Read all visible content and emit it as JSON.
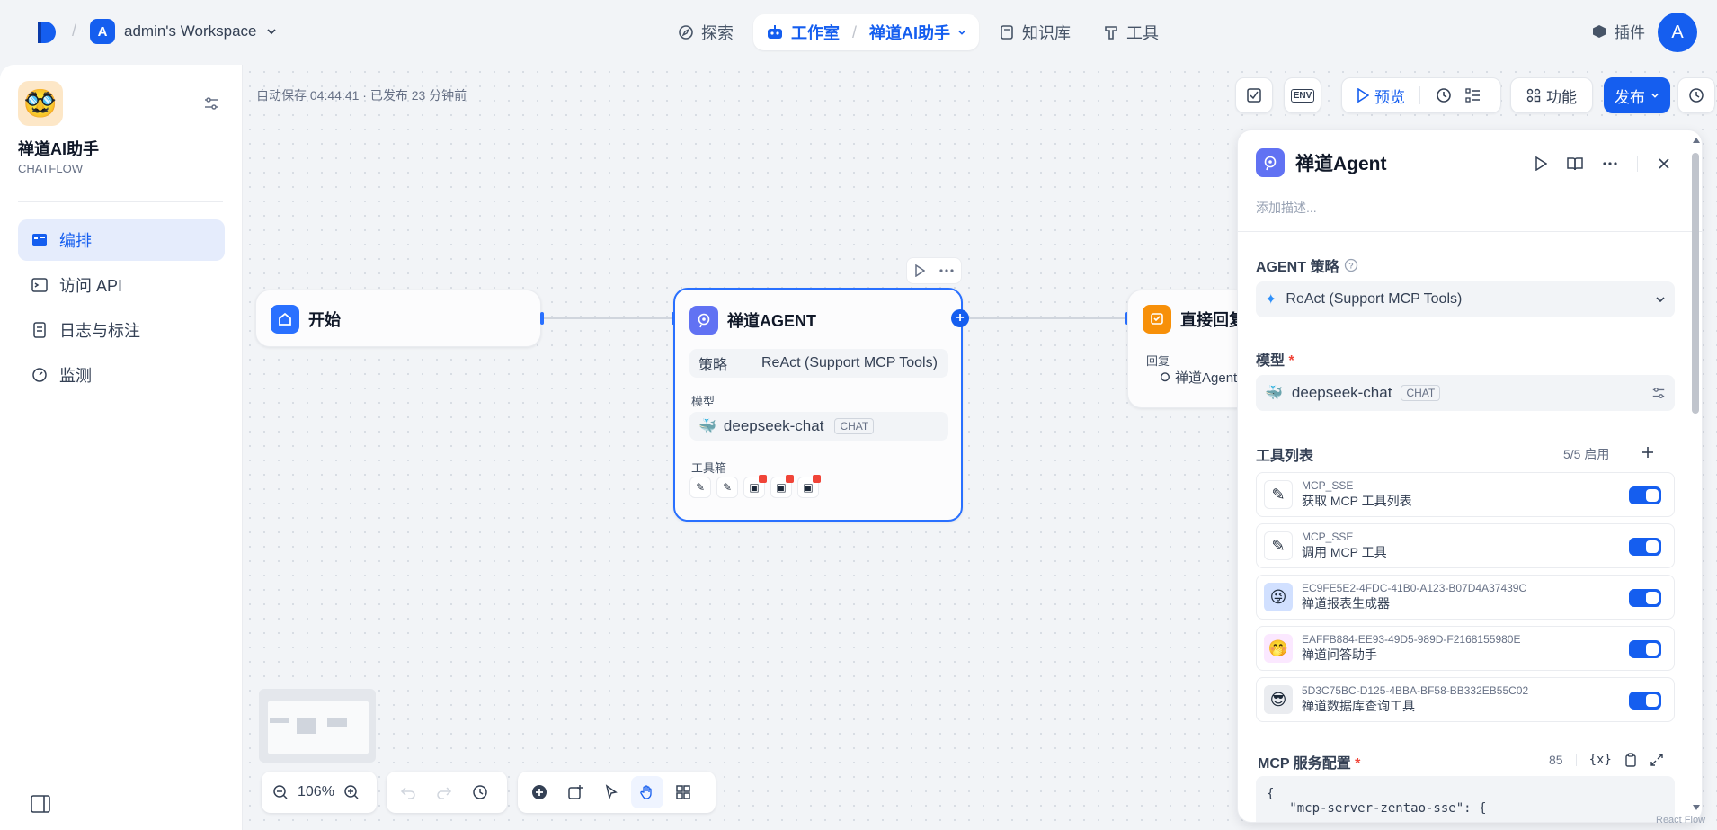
{
  "topbar": {
    "workspace_initial": "A",
    "workspace_name": "admin's Workspace",
    "nav": {
      "explore": "探索",
      "studio": "工作室",
      "current_app": "禅道AI助手",
      "knowledge": "知识库",
      "tools": "工具"
    },
    "plugins": "插件",
    "user_initial": "A"
  },
  "sidebar": {
    "app_name": "禅道AI助手",
    "app_type": "CHATFLOW",
    "items": [
      {
        "label": "编排",
        "icon": "layout-icon",
        "active": true
      },
      {
        "label": "访问 API",
        "icon": "terminal-icon",
        "active": false
      },
      {
        "label": "日志与标注",
        "icon": "log-icon",
        "active": false
      },
      {
        "label": "监测",
        "icon": "monitor-icon",
        "active": false
      }
    ]
  },
  "canvas": {
    "autosave": "自动保存 04:44:41 · 已发布 23 分钟前",
    "toolbar": {
      "env": "ENV",
      "preview": "预览",
      "features": "功能",
      "publish": "发布"
    },
    "zoom": "106%",
    "nodes": {
      "start": {
        "title": "开始"
      },
      "agent": {
        "title": "禅道AGENT",
        "strategy_label": "策略",
        "strategy_value": "ReAct (Support MCP Tools)",
        "model_label": "模型",
        "model_name": "deepseek-chat",
        "model_tag": "CHAT",
        "toolbox_label": "工具箱"
      },
      "answer": {
        "title": "直接回复",
        "reply_label": "回复",
        "reply_value": "禅道Agent"
      }
    },
    "watermark": "React Flow"
  },
  "panel": {
    "title": "禅道Agent",
    "description_placeholder": "添加描述...",
    "strategy_label": "AGENT 策略",
    "strategy_value": "ReAct (Support MCP Tools)",
    "model_label": "模型",
    "model_name": "deepseek-chat",
    "model_tag": "CHAT",
    "tools_label": "工具列表",
    "tools_count": "5/5 启用",
    "tools": [
      {
        "provider": "MCP_SSE",
        "name": "获取 MCP 工具列表",
        "icon": "mcp-icon",
        "enabled": true
      },
      {
        "provider": "MCP_SSE",
        "name": "调用 MCP 工具",
        "icon": "mcp-icon",
        "enabled": true
      },
      {
        "provider": "EC9FE5E2-4FDC-41B0-A123-B07D4A37439C",
        "name": "禅道报表生成器",
        "icon": "emoji-icon",
        "enabled": true
      },
      {
        "provider": "EAFFB884-EE93-49D5-989D-F2168155980E",
        "name": "禅道问答助手",
        "icon": "emoji-icon",
        "enabled": true
      },
      {
        "provider": "5D3C75BC-D125-4BBA-BF58-BB332EB55C02",
        "name": "禅道数据库查询工具",
        "icon": "emoji-icon",
        "enabled": true
      }
    ],
    "mcp_label": "MCP 服务配置",
    "mcp_count": "85",
    "mcp_var": "{x}",
    "mcp_code": "{\n   \"mcp-server-zentao-sse\": {"
  },
  "colors": {
    "primary": "#155eef",
    "start_icon_bg": "#2970ff",
    "agent_icon_bg": "#6172f3",
    "answer_icon_bg": "#f79009"
  }
}
